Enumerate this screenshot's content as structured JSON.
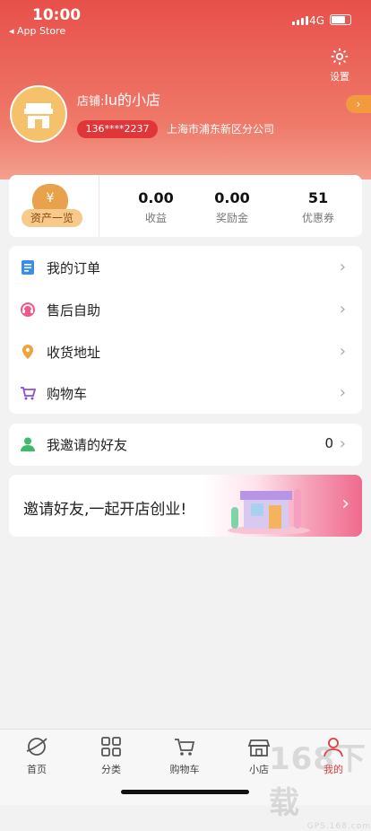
{
  "status": {
    "time": "10:00",
    "back": "App Store",
    "network": "4G"
  },
  "header": {
    "settings_label": "设置",
    "shop_label": "店铺:",
    "shop_name": "lu的小店",
    "phone": "136****2237",
    "branch": "上海市浦东新区分公司"
  },
  "stats": {
    "asset_label": "资产一览",
    "items": [
      {
        "value": "0.00",
        "label": "收益"
      },
      {
        "value": "0.00",
        "label": "奖励金"
      },
      {
        "value": "51",
        "label": "优惠券"
      }
    ]
  },
  "menu": {
    "items": [
      {
        "label": "我的订单",
        "icon": "orders-icon"
      },
      {
        "label": "售后自助",
        "icon": "service-icon"
      },
      {
        "label": "收货地址",
        "icon": "location-icon"
      },
      {
        "label": "购物车",
        "icon": "cart-icon"
      }
    ]
  },
  "invite": {
    "label": "我邀请的好友",
    "count": "0"
  },
  "banner": {
    "text": "邀请好友,一起开店创业!"
  },
  "tabbar": {
    "items": [
      {
        "label": "首页"
      },
      {
        "label": "分类"
      },
      {
        "label": "购物车"
      },
      {
        "label": "小店"
      },
      {
        "label": "我的"
      }
    ],
    "active": "我的"
  },
  "watermark": {
    "main": "168下载",
    "sub": "GPS.168.com"
  },
  "colors": {
    "header": "#e8504a",
    "accent": "#e23a3a",
    "phone_pill": "#e0363a"
  }
}
